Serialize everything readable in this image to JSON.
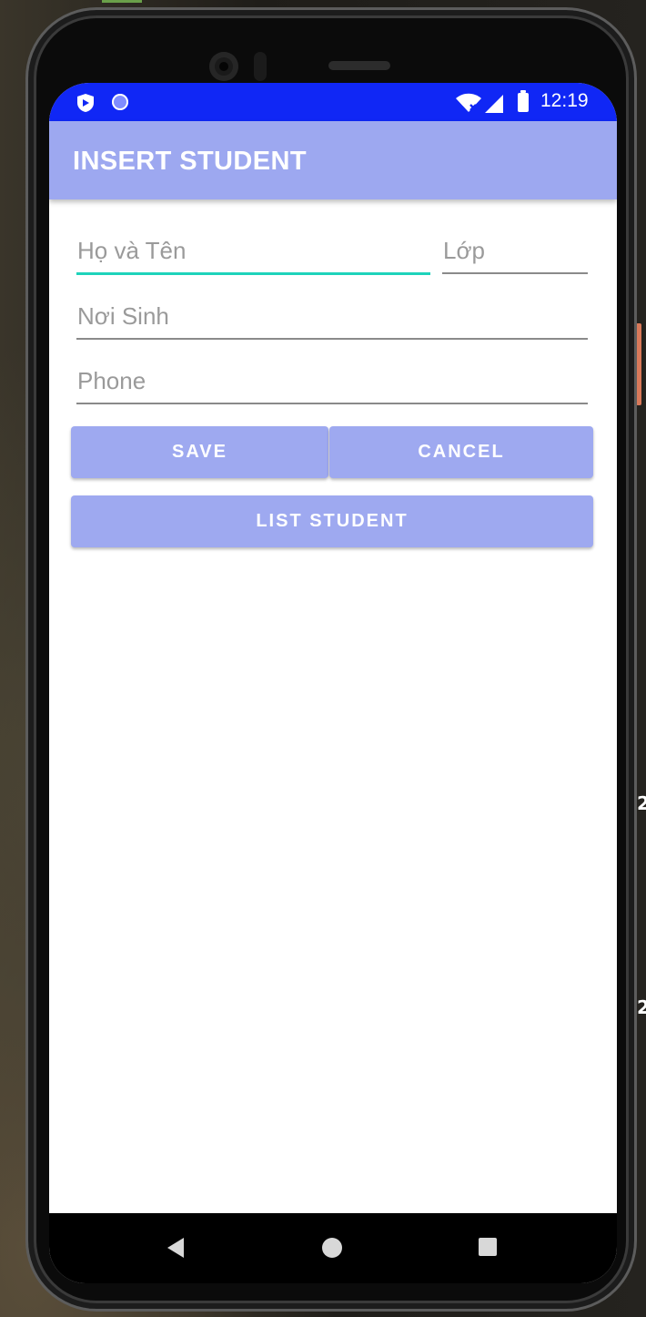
{
  "status_bar": {
    "time": "12:19",
    "left_icons": [
      "shield-icon",
      "circle-icon"
    ],
    "right_icons": [
      "wifi-icon",
      "signal-icon",
      "battery-icon"
    ]
  },
  "app_bar": {
    "title": "INSERT STUDENT",
    "color": "#9da8f0"
  },
  "form": {
    "name_field": {
      "placeholder": "Họ và Tên",
      "value": ""
    },
    "class_field": {
      "placeholder": "Lớp",
      "value": ""
    },
    "birthplace_field": {
      "placeholder": "Nơi Sinh",
      "value": ""
    },
    "phone_field": {
      "placeholder": "Phone",
      "value": ""
    },
    "focus_color": "#1ed3bb"
  },
  "buttons": {
    "save_label": "SAVE",
    "cancel_label": "CANCEL",
    "list_label": "LIST STUDENT",
    "color": "#9ea9f0"
  },
  "nav_bar": {
    "icons": [
      "back-icon",
      "home-icon",
      "recent-apps-icon"
    ]
  },
  "desktop": {
    "side_labels": [
      "2",
      "2"
    ]
  },
  "colors": {
    "status_bar": "#1027f5",
    "screen_background": "#ffffff"
  }
}
